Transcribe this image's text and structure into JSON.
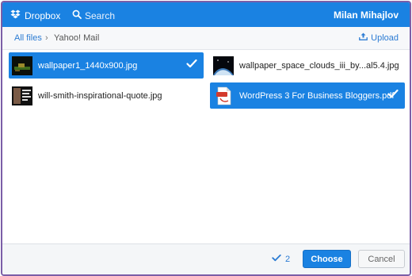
{
  "header": {
    "brand": "Dropbox",
    "search_label": "Search",
    "user_name": "Milan Mihajlov"
  },
  "breadcrumb": {
    "root": "All files",
    "separator": "›",
    "current": "Yahoo! Mail",
    "upload_label": "Upload"
  },
  "files": [
    {
      "name": "wallpaper1_1440x900.jpg",
      "selected": true,
      "type": "image"
    },
    {
      "name": "wallpaper_space_clouds_iii_by...al5.4.jpg",
      "selected": false,
      "type": "image"
    },
    {
      "name": "will-smith-inspirational-quote.jpg",
      "selected": false,
      "type": "image"
    },
    {
      "name": "WordPress 3 For Business Bloggers.pdf",
      "selected": true,
      "type": "pdf"
    }
  ],
  "footer": {
    "selected_count": "2",
    "choose_label": "Choose",
    "cancel_label": "Cancel"
  },
  "colors": {
    "accent": "#1a82e2",
    "frame": "#7b5ea7",
    "link": "#2b7bd3"
  }
}
